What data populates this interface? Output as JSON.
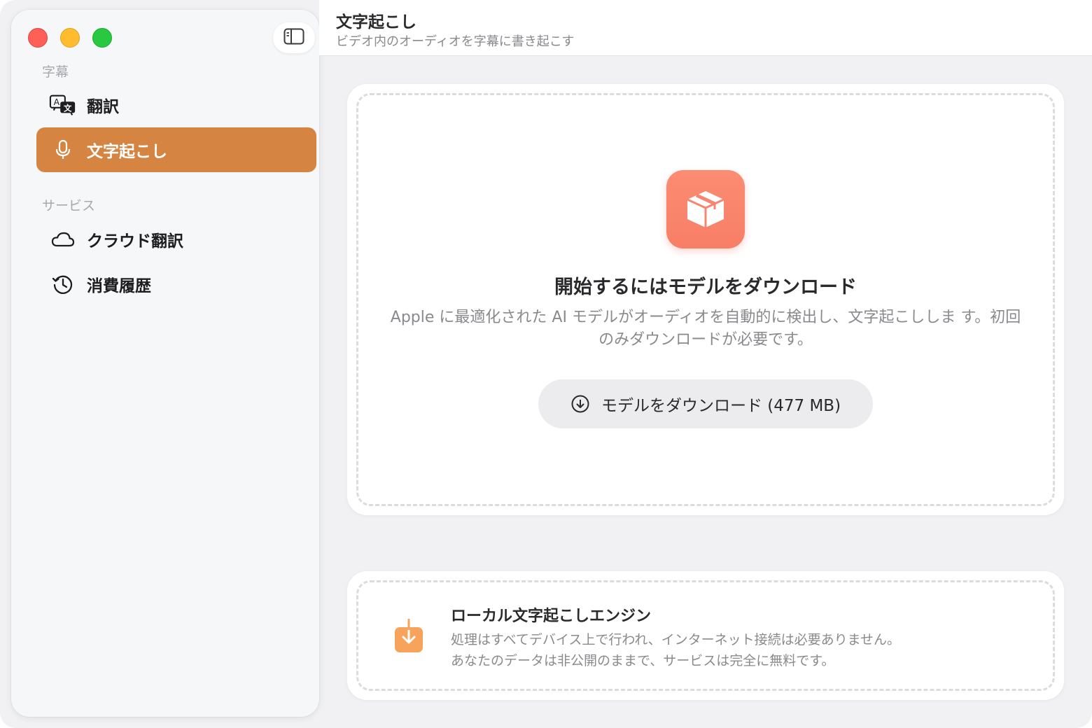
{
  "window": {
    "traffic_lights": [
      "close",
      "minimize",
      "zoom"
    ],
    "colors": {
      "close": "#fe5f57",
      "minimize": "#febc2e",
      "zoom": "#28c840"
    }
  },
  "sidebar": {
    "toggle_icon": "sidebar-toggle-icon",
    "sections": [
      {
        "label": "字幕",
        "items": [
          {
            "label": "翻訳",
            "icon": "translate-icon",
            "active": false
          },
          {
            "label": "文字起こし",
            "icon": "microphone-icon",
            "active": true
          }
        ]
      },
      {
        "label": "サービス",
        "items": [
          {
            "label": "クラウド翻訳",
            "icon": "cloud-icon",
            "active": false
          },
          {
            "label": "消費履歴",
            "icon": "history-icon",
            "active": false
          }
        ]
      }
    ],
    "accent_color": "#d58541"
  },
  "header": {
    "title": "文字起こし",
    "subtitle": "ビデオ内のオーディオを字幕に書き起こす"
  },
  "main_card": {
    "icon": "package-box-icon",
    "title": "開始するにはモデルをダウンロード",
    "description": "Apple に最適化された AI モデルがオーディオを自動的に検出し、文字起こししま す。初回のみダウンロードが必要です。",
    "button_label": "モデルをダウンロード (477 MB)",
    "button_icon": "download-circle-icon",
    "icon_color": "#f98470"
  },
  "engine_card": {
    "icon": "download-tray-icon",
    "title": "ローカル文字起こしエンジン",
    "description_line1": "処理はすべてデバイス上で行われ、インターネット接続は必要ありません。",
    "description_line2": "あなたのデータは非公開のままで、サービスは完全に無料です。",
    "icon_color": "#f7a35c"
  }
}
